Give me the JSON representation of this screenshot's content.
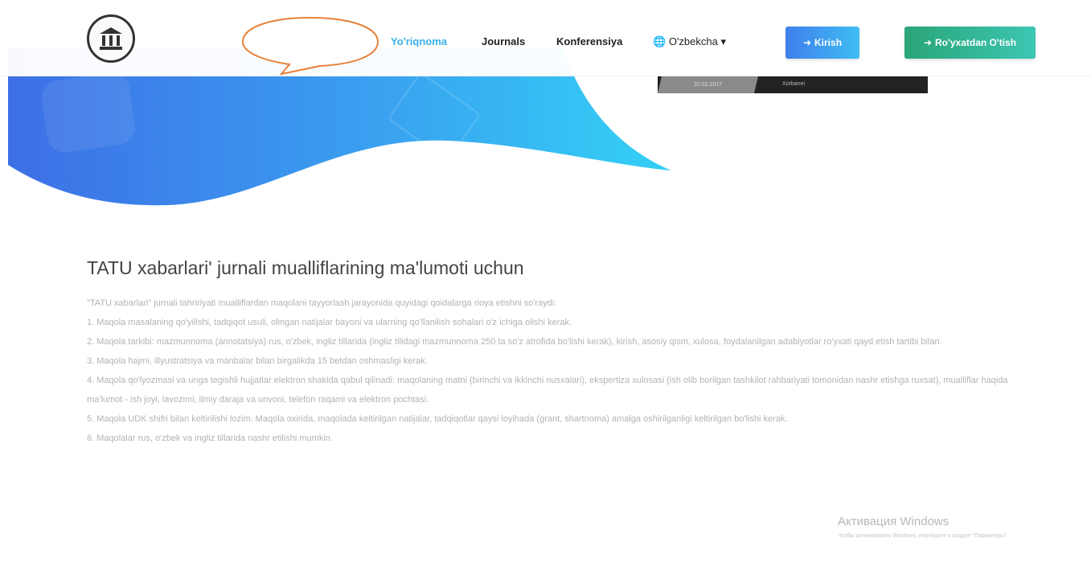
{
  "nav": {
    "links": [
      {
        "label": "Yo'riqnoma",
        "active": true
      },
      {
        "label": "Journals",
        "active": false
      },
      {
        "label": "Konferensiya",
        "active": false
      }
    ],
    "language": "O'zbekcha",
    "login_label": "Kirish",
    "register_label": "Ro'yxatdan O'tish",
    "accent_color": "#3ab0e8"
  },
  "banner": {
    "date": "20.02.2017",
    "caption": "Xorbanei"
  },
  "article": {
    "title": "TATU xabarlari' jurnali mualliflarining ma'lumoti uchun",
    "paragraphs": [
      "\"TATU xabarlari\" jurnali tahririyati mualliflardan maqolani tayyorlash jarayonida quyidagi qoidalarga rioya etishni so'raydi:",
      "1. Maqola masalaning qo'yilishi, tadqiqot usuli, olingan natijalar bayoni va ularning qo'llanilish sohalari o'z ichiga olishi kerak.",
      "2. Maqola tarkibi: mazmunnoma (annotatsiya) rus, o'zbek, ingliz tillarida (ingliz tilidagi mazmunnoma 250 ta so'z atrofida bo'lishi kerak), kirish, asosiy qism, xulosa, foydalanilgan adabiyotlar ro'yxati qayd etish tartibi bilan.",
      "3. Maqola hajmi, illyustratsiya va manbalar bilan birgalikda 15 betdan oshmasligi kerak.",
      "4. Maqola qo'lyozmasi va unga tegishli hujjatlar elektron shaklda qabul qilinadi: maqolaning matni (birinchi va ikkinchi nusxalari), ekspertiza xulosasi (ish olib borilgan tashkilot rahbariyati tomonidan nashr etishga ruxsat), mualliflar haqida ma'lumot - ish joyi, lavozimi, ilmiy daraja va unvoni, telefon raqami va elektron pochtasi.",
      "5. Maqola UDK shifri bilan keltirilishi lozim. Maqola oxirida, maqolada keltirilgan natijalar, tadqiqotlar qaysi loyihada (grant, shartnoma) amalga oshirilganligi keltirilgan bo'lishi kerak.",
      "6. Maqolalar rus, o'zbek va ingliz tillarida nashr etilishi mumkin."
    ]
  },
  "watermark": {
    "title": "Активация Windows",
    "text": "Чтобы активировать Windows, перейдите в раздел \"Параметры\"."
  }
}
